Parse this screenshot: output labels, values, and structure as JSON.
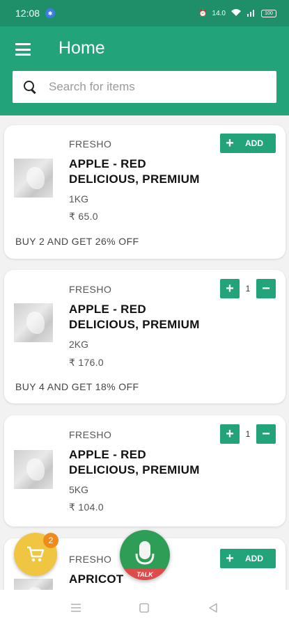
{
  "status": {
    "time": "12:08",
    "icons": [
      "alarm-icon",
      "wifi-icon",
      "signal-icon",
      "battery-icon"
    ],
    "speed": "14.0",
    "battery": "100"
  },
  "header": {
    "title": "Home",
    "search_placeholder": "Search for items"
  },
  "products": [
    {
      "brand": "FRESHO",
      "name": "APPLE - RED DELICIOUS, PREMIUM",
      "qty": "1KG",
      "price": "₹ 65.0",
      "offer": "BUY 2 AND GET 26% OFF",
      "add_label": "ADD"
    },
    {
      "brand": "FRESHO",
      "name": "APPLE - RED DELICIOUS, PREMIUM",
      "qty": "2KG",
      "price": "₹ 176.0",
      "offer": "BUY 4 AND GET 18% OFF",
      "count": "1"
    },
    {
      "brand": "FRESHO",
      "name": "APPLE - RED DELICIOUS, PREMIUM",
      "qty": "5KG",
      "price": "₹ 104.0",
      "count": "1"
    },
    {
      "brand": "FRESHO",
      "name": "APRICOT",
      "add_label": "ADD"
    }
  ],
  "cart": {
    "badge": "2"
  },
  "talk": {
    "label": "TALK"
  },
  "colors": {
    "primary": "#22a37a",
    "status_bar": "#1f8f6a",
    "cart": "#f0c542",
    "badge": "#f08a1c",
    "talk": "#2e9e56",
    "talk_strip": "#e04a4a"
  }
}
